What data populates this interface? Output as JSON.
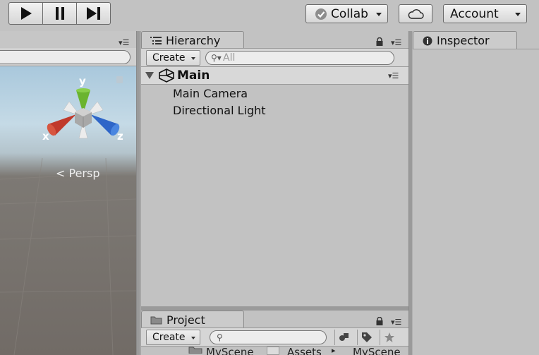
{
  "toolbar": {
    "play_icon": "play-icon",
    "pause_icon": "pause-icon",
    "step_icon": "step-icon",
    "collab_label": "Collab",
    "cloud_icon": "cloud-icon",
    "account_label": "Account"
  },
  "scene": {
    "projection_label": "Persp",
    "gizmo": {
      "y_label": "y",
      "x_label": "x",
      "z_label": "z"
    }
  },
  "hierarchy": {
    "tab_label": "Hierarchy",
    "create_label": "Create",
    "search_placeholder": "All",
    "scene_name": "Main",
    "items": [
      "Main Camera",
      "Directional Light"
    ]
  },
  "project": {
    "tab_label": "Project",
    "create_label": "Create",
    "folder_label": "MyScene",
    "breadcrumb": [
      "Assets",
      "MyScene"
    ]
  },
  "inspector": {
    "tab_label": "Inspector"
  },
  "colors": {
    "gizmo_y": "#6ab42f",
    "gizmo_x": "#c0392b",
    "gizmo_z": "#2f66c8"
  }
}
